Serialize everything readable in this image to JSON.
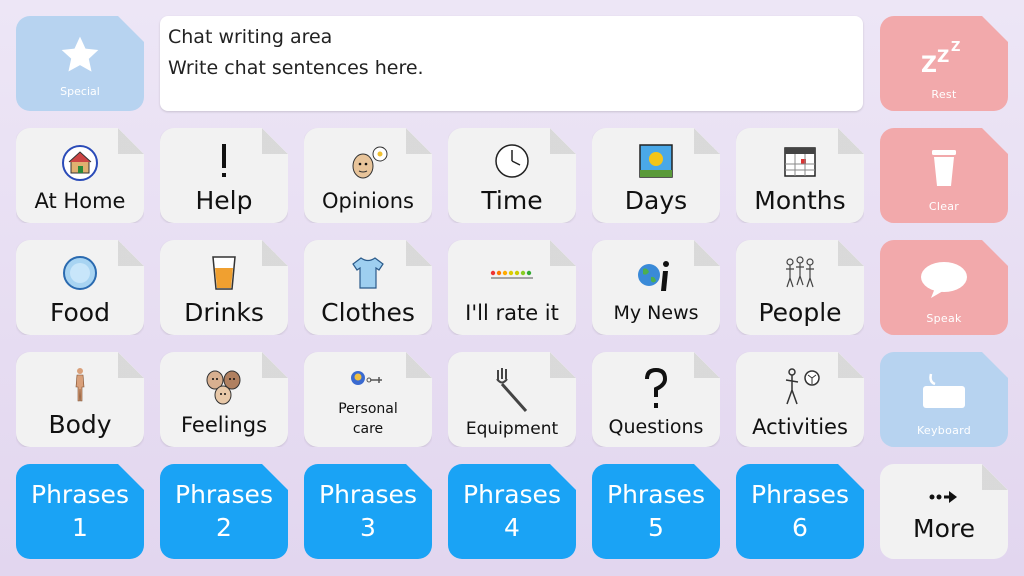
{
  "chat": {
    "line1": "Chat writing area",
    "line2": "Write chat sentences here."
  },
  "controls": {
    "special": "Special",
    "rest": "Rest",
    "clear": "Clear",
    "speak": "Speak",
    "keyboard": "Keyboard",
    "more": "More"
  },
  "tiles": {
    "row1": [
      "At Home",
      "Help",
      "Opinions",
      "Time",
      "Days",
      "Months"
    ],
    "row2": [
      "Food",
      "Drinks",
      "Clothes",
      "I'll rate it",
      "My News",
      "People"
    ],
    "row3": [
      "Body",
      "Feelings",
      "Personal care",
      "Equipment",
      "Questions",
      "Activities"
    ]
  },
  "phrases": [
    {
      "word": "Phrases",
      "num": "1"
    },
    {
      "word": "Phrases",
      "num": "2"
    },
    {
      "word": "Phrases",
      "num": "3"
    },
    {
      "word": "Phrases",
      "num": "4"
    },
    {
      "word": "Phrases",
      "num": "5"
    },
    {
      "word": "Phrases",
      "num": "6"
    }
  ],
  "colors": {
    "phrase_blue": "#1aa3f5",
    "control_red": "#f2a9ab",
    "control_blue": "#b7d3f0",
    "tile_grey": "#f2f2f2"
  },
  "icons": {
    "special": "star-icon",
    "rest": "zzz-icon",
    "clear": "trash-icon",
    "speak": "speech-bubble-icon",
    "keyboard": "keyboard-icon",
    "more": "arrow-right-icon"
  }
}
